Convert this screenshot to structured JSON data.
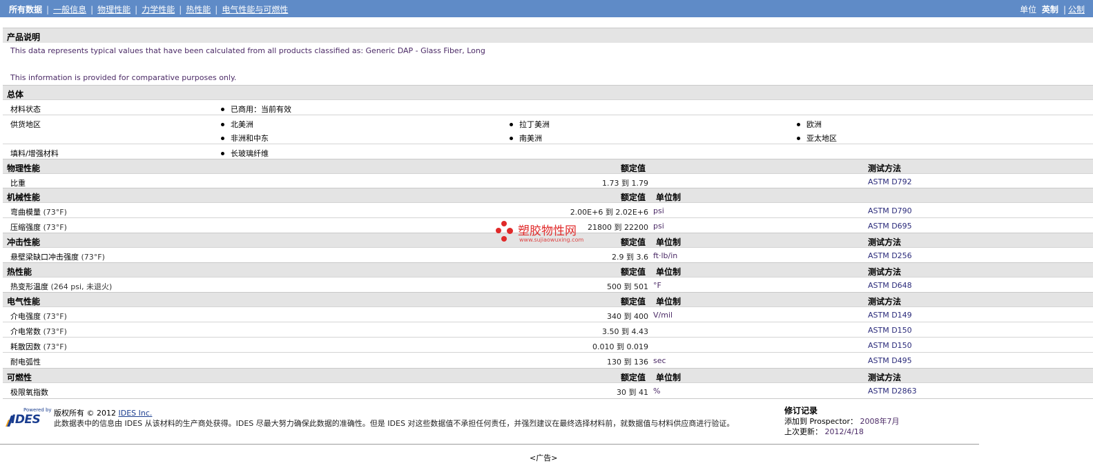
{
  "nav": {
    "current": "所有数据",
    "links": [
      "一般信息",
      "物理性能",
      "力学性能",
      "热性能",
      "电气性能与可燃性"
    ],
    "separator": "|"
  },
  "units": {
    "label": "单位",
    "active": "英制",
    "separator": "|",
    "alternate": "公制"
  },
  "description": {
    "header": "产品说明",
    "line1": "This data represents typical values that have been calculated from all products classified as: Generic DAP - Glass Fiber, Long",
    "line2": "This information is provided for comparative purposes only."
  },
  "general": {
    "header": "总体",
    "status_label": "材料状态",
    "status_value": "已商用：当前有效",
    "supply_label": "供货地区",
    "regions": [
      "北美洲",
      "拉丁美洲",
      "欧洲",
      "非洲和中东",
      "南美洲",
      "亚太地区"
    ],
    "filler_label": "填料/增强材料",
    "filler_value": "长玻璃纤维"
  },
  "columns": {
    "nominal": "额定值",
    "unit": "单位制",
    "method": "测试方法"
  },
  "physical": {
    "header": "物理性能",
    "rows": [
      {
        "label": "比重",
        "cond": "",
        "value": "1.73 到  1.79",
        "unit": "",
        "method": "ASTM D792"
      }
    ]
  },
  "mechanical": {
    "header": "机械性能",
    "rows": [
      {
        "label": "弯曲模量",
        "cond": "(73°F)",
        "value": "2.00E+6 到  2.02E+6",
        "unit": "psi",
        "method": "ASTM D790"
      },
      {
        "label": "压缩强度",
        "cond": "(73°F)",
        "value": "21800 到  22200",
        "unit": "psi",
        "method": "ASTM D695"
      }
    ]
  },
  "impact": {
    "header": "冲击性能",
    "rows": [
      {
        "label": "悬壁梁缺口冲击强度",
        "cond": "(73°F)",
        "value": "2.9 到  3.6",
        "unit": "ft·lb/in",
        "method": "ASTM D256"
      }
    ]
  },
  "thermal": {
    "header": "热性能",
    "rows": [
      {
        "label": "热变形温度",
        "cond": "(264 psi, 未退火)",
        "value": "500 到  501",
        "unit": "°F",
        "method": "ASTM D648"
      }
    ]
  },
  "electrical": {
    "header": "电气性能",
    "rows": [
      {
        "label": "介电强度",
        "cond": "(73°F)",
        "value": "340 到  400",
        "unit": "V/mil",
        "method": "ASTM D149"
      },
      {
        "label": "介电常数",
        "cond": "(73°F)",
        "value": "3.50 到  4.43",
        "unit": "",
        "method": "ASTM D150"
      },
      {
        "label": "耗散因数",
        "cond": "(73°F)",
        "value": "0.010 到  0.019",
        "unit": "",
        "method": "ASTM D150"
      },
      {
        "label": "耐电弧性",
        "cond": "",
        "value": "130 到  136",
        "unit": "sec",
        "method": "ASTM D495"
      }
    ]
  },
  "flammability": {
    "header": "可燃性",
    "rows": [
      {
        "label": "极限氧指数",
        "cond": "",
        "value": "30 到  41",
        "unit": "%",
        "method": "ASTM D2863"
      }
    ]
  },
  "watermark": {
    "text": "塑胶物性网",
    "url": "www.sujiaowuxing.com"
  },
  "footer": {
    "logo_powered": "Powered by",
    "logo_word": "IDES",
    "copyright": "版权所有 © 2012",
    "company_link": "IDES Inc.",
    "disclaimer": "此数据表中的信息由 IDES 从该材料的生产商处获得。IDES 尽最大努力确保此数据的准确性。但是 IDES 对这些数据值不承担任何责任，并强烈建议在最终选择材料前，就数据值与材料供应商进行验证。",
    "revision_header": "修订记录",
    "added_label": "添加到 Prospector：",
    "added_value": "2008年7月",
    "updated_label": "上次更新：",
    "updated_value": "2012/4/18",
    "ad": "<广告>"
  }
}
